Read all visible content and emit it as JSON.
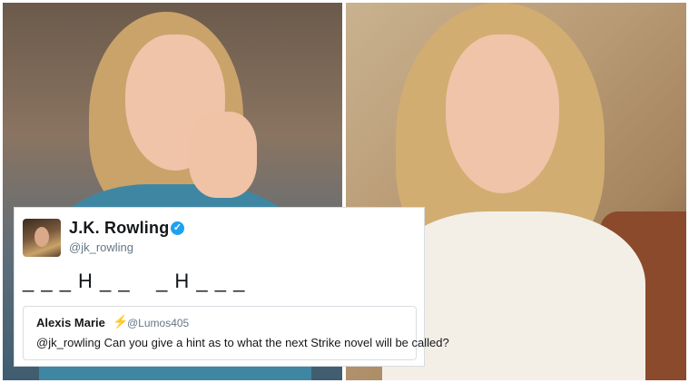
{
  "tweet": {
    "author_name": "J.K. Rowling",
    "verified_badge": "✓",
    "author_handle": "@jk_rowling",
    "text": "_ _ _ H _ _    _ H _ _ _",
    "quoted": {
      "author_name": "Alexis Marie",
      "emoji": "⚡",
      "author_handle": "@Lumos405",
      "text": "@jk_rowling Can you give a hint as to what the next Strike novel will be called?"
    }
  },
  "colors": {
    "verified": "#1da1f2",
    "text": "#14171a",
    "secondary_text": "#657786"
  }
}
